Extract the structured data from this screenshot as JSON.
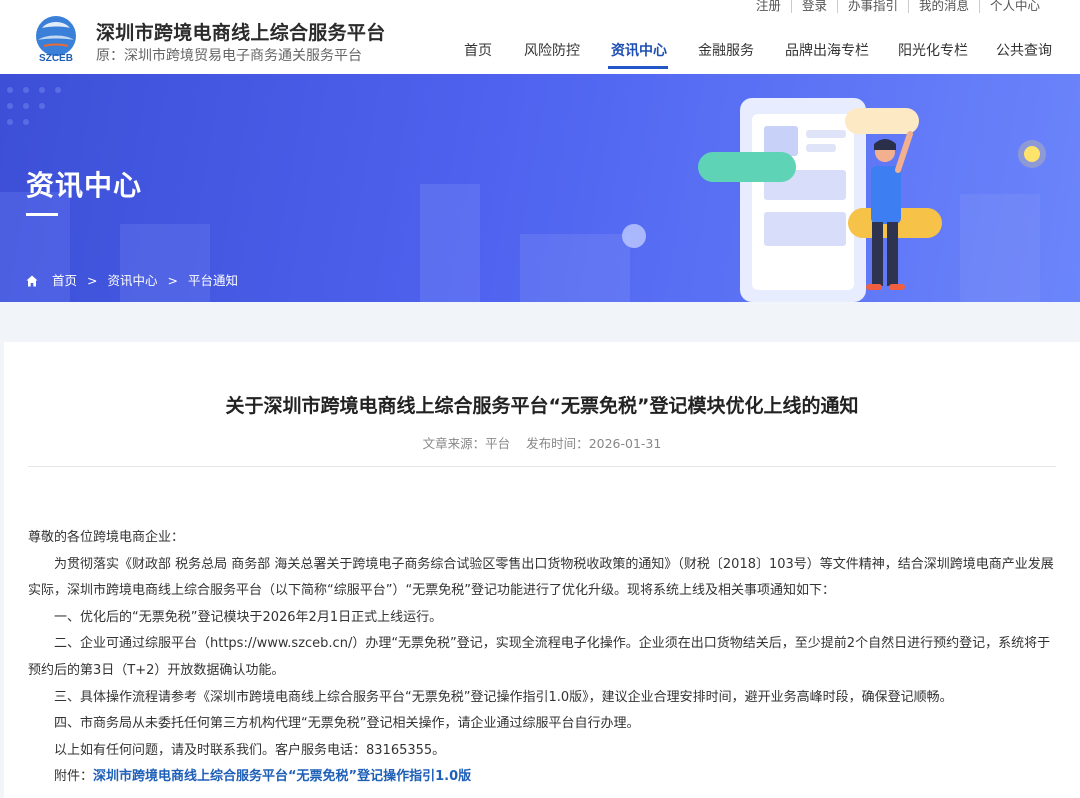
{
  "header": {
    "title": "深圳市跨境电商线上综合服务平台",
    "subtitle": "原：深圳市跨境贸易电子商务通关服务平台",
    "logo_text": "SZCEB",
    "topbar": [
      "注册",
      "登录",
      "办事指引",
      "我的消息",
      "个人中心"
    ],
    "nav": [
      "首页",
      "风险防控",
      "资讯中心",
      "金融服务",
      "品牌出海专栏",
      "阳光化专栏",
      "公共查询"
    ],
    "active_nav": "资讯中心"
  },
  "banner": {
    "title": "资讯中心",
    "breadcrumb": [
      "首页",
      "资讯中心",
      "平台通知"
    ],
    "breadcrumb_sep": ">"
  },
  "article": {
    "title": "关于深圳市跨境电商线上综合服务平台“无票免税”登记模块优化上线的通知",
    "source_label": "文章来源：",
    "source": "平台",
    "date_label": "发布时间：",
    "date": "2026-01-31",
    "greeting": "尊敬的各位跨境电商企业：",
    "paragraphs": [
      "为贯彻落实《财政部 税务总局 商务部 海关总署关于跨境电子商务综合试验区零售出口货物税收政策的通知》（财税〔2018〕103号）等文件精神，结合深圳跨境电商产业发展实际，深圳市跨境电商线上综合服务平台（以下简称“综服平台”）“无票免税”登记功能进行了优化升级。现将系统上线及相关事项通知如下：",
      "一、优化后的“无票免税”登记模块于2026年2月1日正式上线运行。",
      "二、企业可通过综服平台（https://www.szceb.cn/）办理“无票免税”登记，实现全流程电子化操作。企业须在出口货物结关后，至少提前2个自然日进行预约登记，系统将于预约后的第3日（T+2）开放数据确认功能。",
      "三、具体操作流程请参考《深圳市跨境电商线上综合服务平台“无票免税”登记操作指引1.0版》，建议企业合理安排时间，避开业务高峰时段，确保登记顺畅。",
      "四、市商务局从未委托任何第三方机构代理“无票免税”登记相关操作，请企业通过综服平台自行办理。",
      "以上如有任何问题，请及时联系我们。客户服务电话：83165355。"
    ],
    "attachment_label": "附件：",
    "attachment": "深圳市跨境电商线上综合服务平台“无票免税”登记操作指引1.0版"
  },
  "colors": {
    "brand_blue": "#2356c6",
    "banner_start": "#3c4fd6",
    "banner_end": "#6b85fb",
    "link": "#1e5fb8"
  }
}
